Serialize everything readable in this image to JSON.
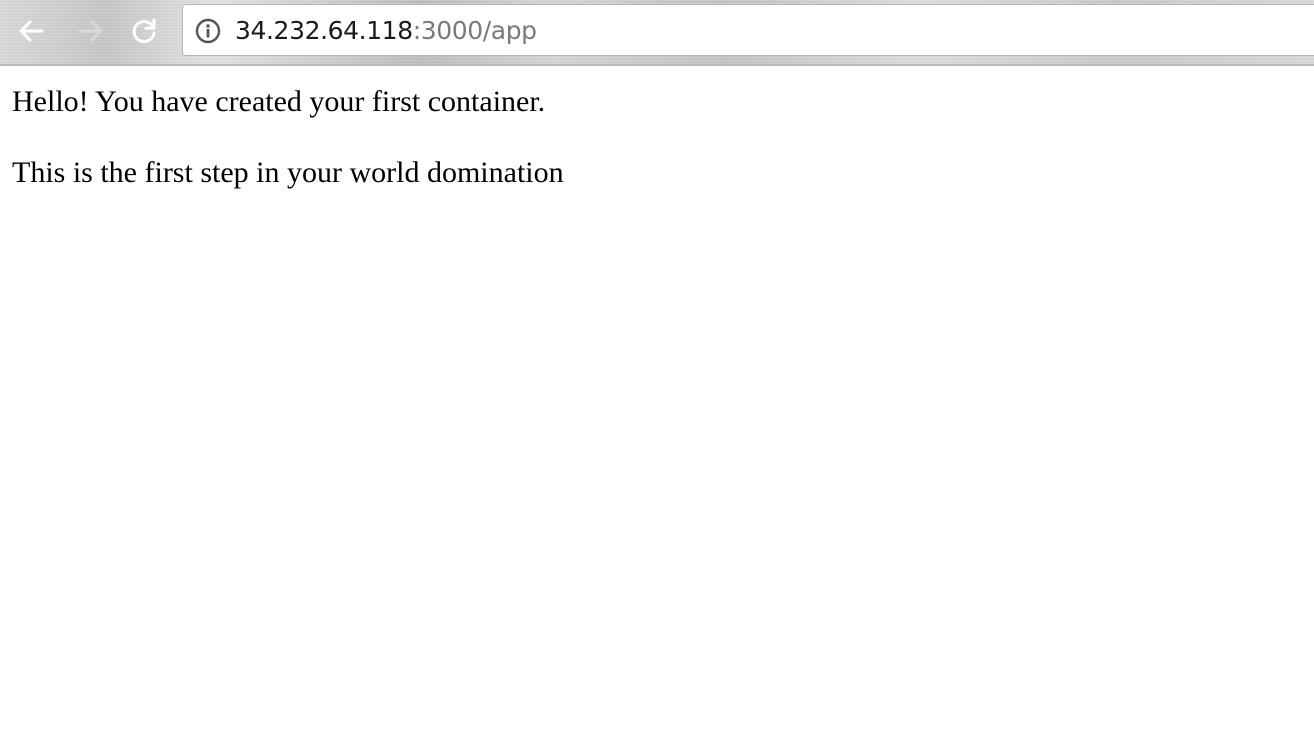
{
  "browser": {
    "address_bar": {
      "host": "34.232.64.118",
      "rest": ":3000/app"
    },
    "icons": {
      "back": "back-arrow-icon",
      "forward": "forward-arrow-icon",
      "reload": "reload-icon",
      "info": "info-icon"
    }
  },
  "page": {
    "line1": "Hello! You have created your first container.",
    "line2": "This is the first step in your world domination"
  }
}
